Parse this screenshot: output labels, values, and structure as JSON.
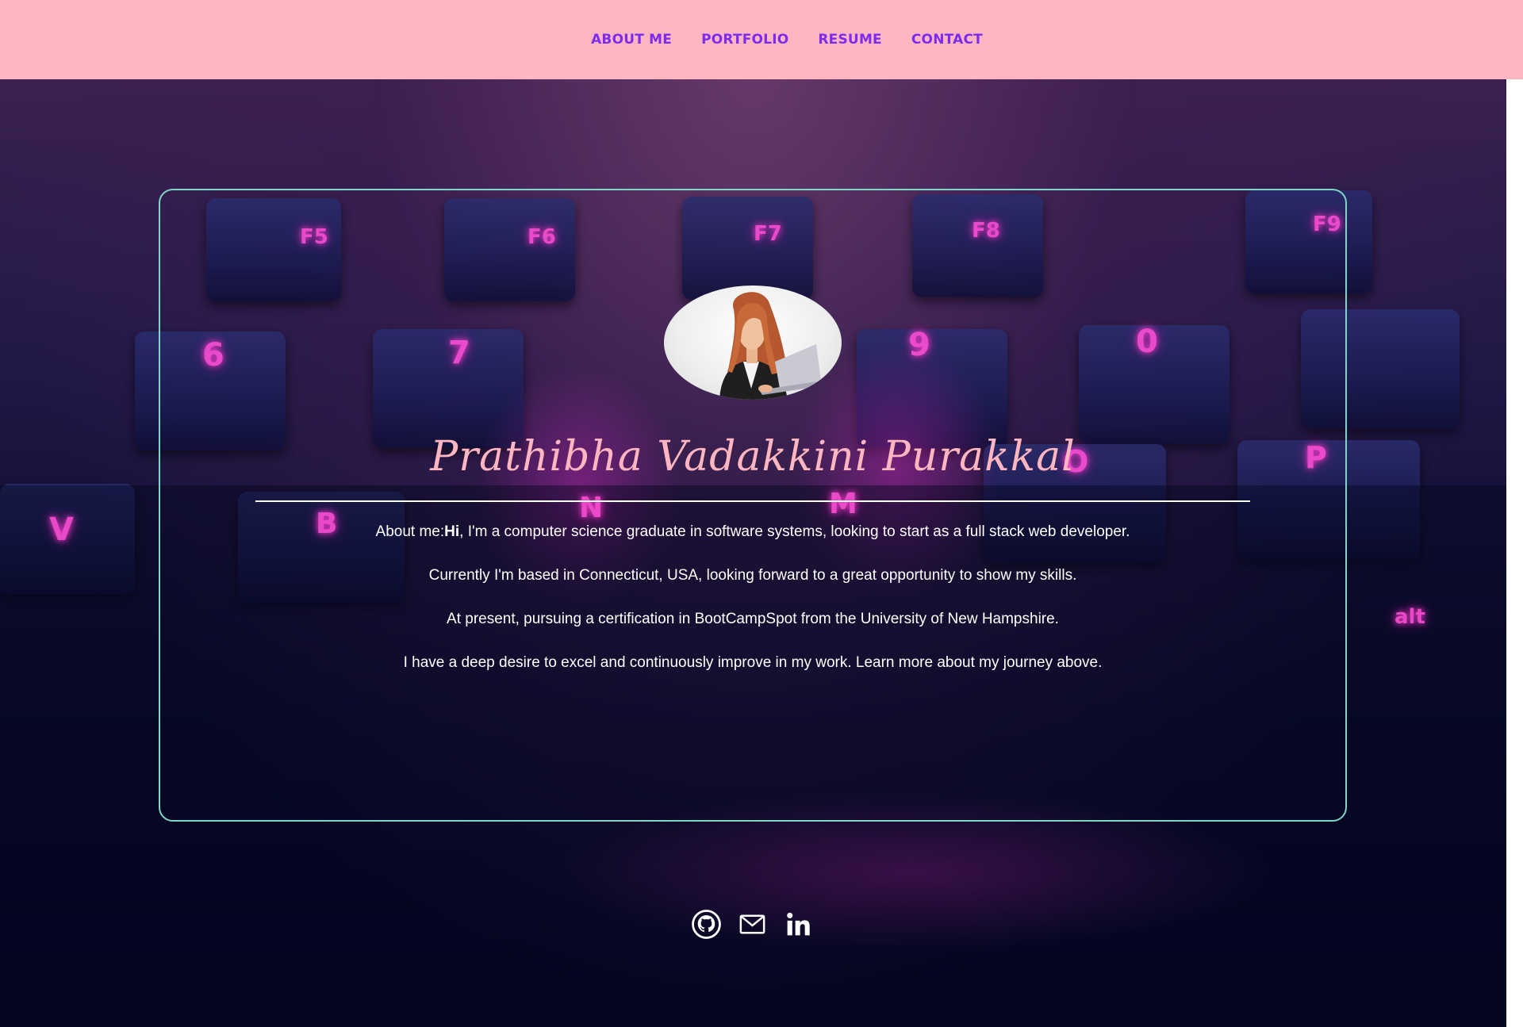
{
  "nav": {
    "items": [
      {
        "label": "ABOUT ME"
      },
      {
        "label": "PORTFOLIO"
      },
      {
        "label": "RESUME"
      },
      {
        "label": "CONTACT"
      }
    ]
  },
  "hero": {
    "keyboard_labels": [
      "F5",
      "F6",
      "F7",
      "F8",
      "F9",
      "6",
      "7",
      "9",
      "0",
      "O",
      "P",
      "V",
      "B",
      "N",
      "M",
      "alt"
    ]
  },
  "profile": {
    "name": "Prathibha Vadakkini Purakkal",
    "about_prefix": "About me:",
    "about_hi": "Hi",
    "about_line1_rest": ", I'm a computer science graduate in software systems, looking to start as a full stack web developer.",
    "about_line2": "Currently I'm based in Connecticut, USA, looking forward to a great opportunity to show my skills.",
    "about_line3": "At present, pursuing a certification in BootCampSpot from the University of New Hampshire.",
    "about_line4": "I have a deep desire to excel and continuously improve in my work. Learn more about my journey above."
  },
  "social": {
    "icons": [
      "github-icon",
      "mail-icon",
      "linkedin-icon"
    ]
  },
  "colors": {
    "nav_bg": "#ffb6c1",
    "nav_link": "#7b2cf0",
    "name": "#ffb6c1",
    "card_border": "#7fd6c6",
    "key_glow": "#ff4fd8"
  }
}
